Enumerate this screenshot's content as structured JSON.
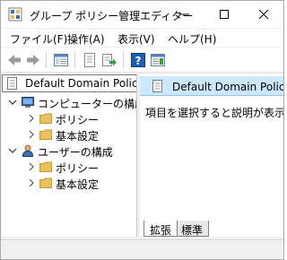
{
  "window": {
    "title": "グループ ポリシー管理エディター"
  },
  "menubar": {
    "items": [
      {
        "label": "ファイル(F)"
      },
      {
        "label": "操作(A)"
      },
      {
        "label": "表示(V)"
      },
      {
        "label": "ヘルプ(H)"
      }
    ]
  },
  "toolbar": {
    "tools": [
      "back-arrow-icon",
      "forward-arrow-icon",
      "show-hide-console-tree-icon",
      "properties-icon",
      "export-list-icon",
      "help-icon",
      "show-action-pane-icon"
    ]
  },
  "tree": {
    "root_label": "Default Domain Policy [",
    "computer_config_label": "コンピューターの構成",
    "computer_policy_label": "ポリシー",
    "computer_preferences_label": "基本設定",
    "user_config_label": "ユーザーの構成",
    "user_policy_label": "ポリシー",
    "user_preferences_label": "基本設定"
  },
  "details": {
    "header_label": "Default Domain Policy [",
    "description": "項目を選択すると説明が表示され"
  },
  "tabs": {
    "extended_label": "拡張",
    "standard_label": "標準"
  },
  "colors": {
    "selection_bg": "#cce8ff",
    "folder": "#e8c15a",
    "help_blue": "#1a5fb4"
  }
}
